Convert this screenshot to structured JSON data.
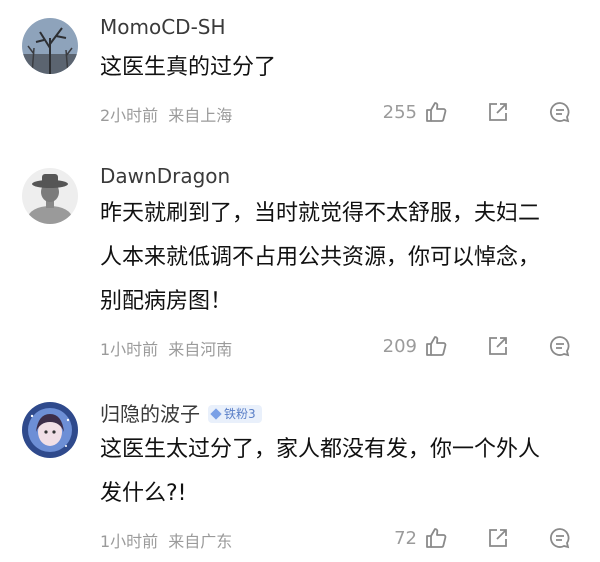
{
  "comments": [
    {
      "username": "MomoCD-SH",
      "badge": "",
      "lines": [
        "这医生真的过分了"
      ],
      "time": "2小时前",
      "location": "来自上海",
      "likes": "255",
      "avatar_icon": "winter-tree-avatar"
    },
    {
      "username": "DawnDragon",
      "badge": "",
      "lines": [
        "昨天就刷到了，当时就觉得不太舒服，夫妇二",
        "人本来就低调不占用公共资源，你可以悼念，",
        "别配病房图！"
      ],
      "time": "1小时前",
      "location": "来自河南",
      "likes": "209",
      "avatar_icon": "person-with-hat-avatar"
    },
    {
      "username": "归隐的波子",
      "badge": "铁粉3",
      "lines": [
        "这医生太过分了，家人都没有发，你一个外人",
        "发什么?!"
      ],
      "time": "1小时前",
      "location": "来自广东",
      "likes": "72",
      "avatar_icon": "anime-girl-avatar"
    }
  ],
  "icons": {
    "like": "thumbs-up-icon",
    "share": "share-icon",
    "reply": "comment-icon"
  },
  "colors": {
    "username": "#3a3a3a",
    "meta": "#9b9b9b",
    "badge_bg": "#e9f0fb",
    "badge_text": "#5a7fc7"
  }
}
